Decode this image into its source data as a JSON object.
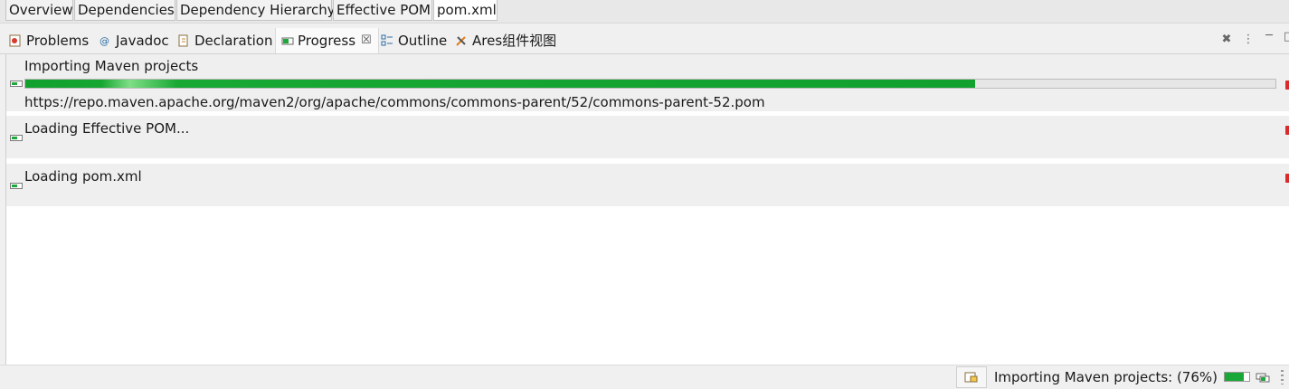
{
  "editor_tabs": [
    "Overview",
    "Dependencies",
    "Dependency Hierarchy",
    "Effective POM",
    "pom.xml"
  ],
  "view_tabs": [
    {
      "label": "Problems",
      "icon": "problems-icon"
    },
    {
      "label": "Javadoc",
      "icon": "javadoc-icon"
    },
    {
      "label": "Declaration",
      "icon": "declaration-icon"
    },
    {
      "label": "Progress",
      "icon": "progress-icon",
      "active": true,
      "close": "☒"
    },
    {
      "label": "Outline",
      "icon": "outline-icon"
    },
    {
      "label": "Ares组件视图",
      "icon": "ares-icon"
    }
  ],
  "view_toolbar": {
    "remove_all": "✖",
    "menu": "⋮",
    "minimize": "─",
    "maximize": "□"
  },
  "jobs": [
    {
      "title": "Importing Maven projects",
      "progress": 0.76,
      "detail": "https://repo.maven.apache.org/maven2/org/apache/commons/commons-parent/52/commons-parent-52.pom"
    },
    {
      "title": "Loading Effective POM..."
    },
    {
      "title": "Loading pom.xml"
    }
  ],
  "status_bar": {
    "text": "Importing Maven projects: (76%)",
    "progress": 0.76
  },
  "colors": {
    "progress_green": "#12a02e",
    "stop_red": "#d92b2b"
  }
}
